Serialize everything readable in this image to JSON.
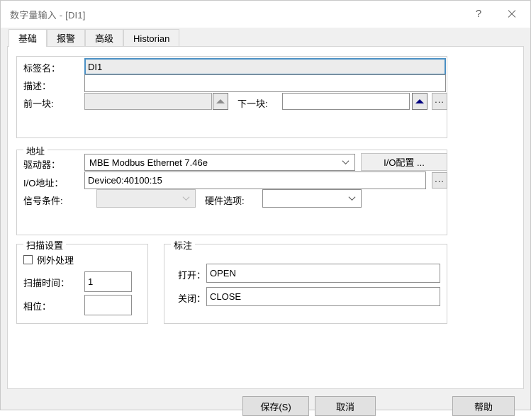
{
  "window": {
    "title": "数字量输入 - [DI1]",
    "help_icon": "question-mark-icon",
    "close_icon": "close-icon"
  },
  "tabs": [
    {
      "label": "基础",
      "active": true
    },
    {
      "label": "报警",
      "active": false
    },
    {
      "label": "高级",
      "active": false
    },
    {
      "label": "Historian",
      "active": false
    }
  ],
  "identity_group": {
    "tag_name_label": "标签名：",
    "tag_name_value": "DI1",
    "description_label": "描述：",
    "description_value": "",
    "prev_block_label": "前一块:",
    "prev_block_value": "",
    "next_block_label": "下一块:",
    "next_block_value": "",
    "prev_spin_icon": "triangle-up-icon",
    "next_spin_icon": "triangle-up-icon",
    "browse_label": "..."
  },
  "address_group": {
    "legend": "地址",
    "driver_label": "驱动器：",
    "driver_value": "MBE    Modbus Ethernet 7.46e",
    "io_config_label": "I/O配置 ...",
    "io_address_label": "I/O地址：",
    "io_address_value": "Device0:40100:15",
    "io_address_browse_label": "...",
    "signal_condition_label": "信号条件:",
    "signal_condition_value": "",
    "hardware_options_label": "硬件选项:",
    "hardware_options_value": ""
  },
  "scan_group": {
    "legend": "扫描设置",
    "exception_label": "例外处理",
    "exception_checked": false,
    "scan_time_label": "扫描时间：",
    "scan_time_value": "1",
    "phase_label": "相位：",
    "phase_value": ""
  },
  "annotation_group": {
    "legend": "标注",
    "open_label": "打开：",
    "open_value": "OPEN",
    "close_label": "关闭：",
    "close_value": "CLOSE"
  },
  "footer": {
    "save_label": "保存(S)",
    "cancel_label": "取消",
    "help_label": "帮助"
  },
  "colors": {
    "dialog_bg": "#f0f0f0",
    "panel_bg": "#ffffff",
    "accent_spinner": "#000080",
    "focus_border": "#4a90c4"
  }
}
